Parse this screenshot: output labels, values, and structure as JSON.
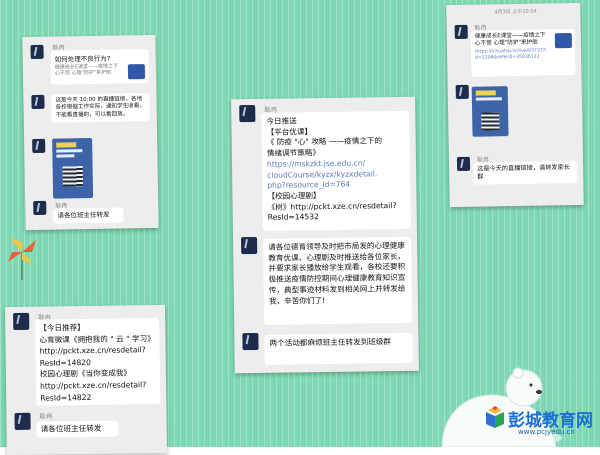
{
  "background": {
    "color": "#7fd8b3"
  },
  "panel1": {
    "messages": [
      {
        "sender": "耿冉",
        "title": "如何处理不良行为?",
        "desc": "健康成长E课堂——疫情之下心不慌 心理\"防护\"来护航"
      },
      {
        "sender": "耿冉",
        "text": "这是今天 10:00 的直播链接，各地各校根据工作实际，通知学生收看，不能看直播的，可以看回放。"
      },
      {
        "sender": "耿冉",
        "text": "请各位班主任转发"
      }
    ]
  },
  "panel2": {
    "sender": "耿冉",
    "msg1": {
      "l1": "今日推送",
      "l2": "【平台优课】",
      "l3": "《 防疫 \"心\" 攻略 ——疫情之下的",
      "l4": "情绪调节策略》",
      "l5": "https://mskzkt.jse.edu.cn/",
      "l6": "cloudCourse/kyzx/kyzxdetail.",
      "l7": "php?resource_id=764",
      "l8": "【校园心理剧】",
      "l9": "《树》http://pckt.xze.cn/resdetail?",
      "l10": "ResId=14532"
    },
    "msg2": "请各位德育领导及时把市局发的心理健康教育优课、心理剧及时推送给各位家长，并要求家长播放给学生观看，各校还要积极推送疫情防控期间心理健康教育知识宣传，典型事迹材料发到相关网上并转发给我，辛苦你们了!",
    "msg3": "两个活动都麻烦班主任转发到班级群"
  },
  "panel3": {
    "header": "4月3日 上午10:54",
    "messages": [
      {
        "sender": "耿冉",
        "text": "健康成长E课堂——疫情之下心不慌 心理\"防护\"来护航",
        "link": "https://v.huahai.tv/live/83737?id=1206&referid=35036122"
      },
      {
        "sender": "耿冉",
        "text": ""
      },
      {
        "sender": "耿冉",
        "text": "这是今天的直播链接，请转发家长群"
      }
    ]
  },
  "panel4": {
    "messages": [
      {
        "sender": "耿冉",
        "l1": "【今日推荐】",
        "l2": "心育微课《拥抱我的 \" 云 \" 学习》",
        "l3": "http://pckt.xze.cn/resdetail?",
        "l4": "ResId=14820",
        "l5": "校园心理剧《当你变成我》",
        "l6": "http://pckt.xze.cn/resdetail?",
        "l7": "ResId=14822"
      },
      {
        "sender": "耿冉",
        "text": "请各位班主任转发"
      }
    ]
  },
  "logo": {
    "name": "彭城教育网",
    "url": "www.pcjyedu.cn"
  }
}
